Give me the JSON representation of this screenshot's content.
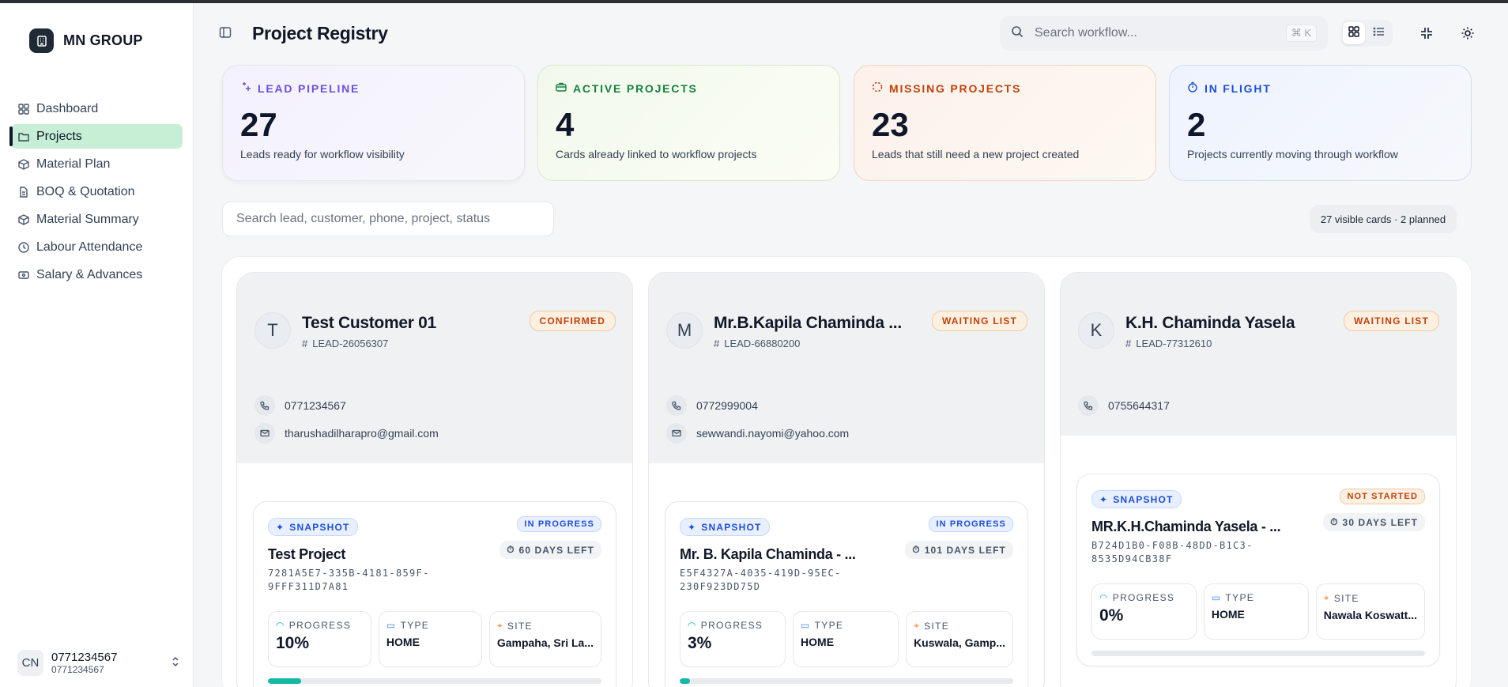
{
  "brand": {
    "name": "MN GROUP"
  },
  "sidebar": {
    "items": [
      {
        "label": "Dashboard",
        "icon": "grid-icon"
      },
      {
        "label": "Projects",
        "icon": "folder-icon"
      },
      {
        "label": "Material Plan",
        "icon": "box-icon"
      },
      {
        "label": "BOQ & Quotation",
        "icon": "document-icon"
      },
      {
        "label": "Material Summary",
        "icon": "box-icon"
      },
      {
        "label": "Labour Attendance",
        "icon": "clock-icon"
      },
      {
        "label": "Salary & Advances",
        "icon": "wallet-icon"
      }
    ],
    "active": "Projects"
  },
  "user": {
    "initials": "CN",
    "name": "0771234567",
    "sub": "0771234567"
  },
  "header": {
    "title": "Project Registry",
    "search_placeholder": "Search workflow...",
    "shortcut": "⌘ K"
  },
  "stats": [
    {
      "label": "LEAD PIPELINE",
      "value": "27",
      "desc": "Leads ready for workflow visibility",
      "color": "#6d4fd8"
    },
    {
      "label": "ACTIVE PROJECTS",
      "value": "4",
      "desc": "Cards already linked to workflow projects",
      "color": "#15803d"
    },
    {
      "label": "MISSING PROJECTS",
      "value": "23",
      "desc": "Leads that still need a new project created",
      "color": "#c2410c"
    },
    {
      "label": "IN FLIGHT",
      "value": "2",
      "desc": "Projects currently moving through workflow",
      "color": "#1d4ed8"
    }
  ],
  "lead_search": {
    "placeholder": "Search lead, customer, phone, project, status"
  },
  "visible_count": "27 visible cards · 2 planned",
  "cards": [
    {
      "letter": "T",
      "name": "Test Customer 01",
      "lead_id": "LEAD-26056307",
      "status": "CONFIRMED",
      "phone": "0771234567",
      "email": "tharushadilharapro@gmail.com",
      "snapshot": {
        "tag": "SNAPSHOT",
        "status": "IN PROGRESS",
        "days": "60 DAYS LEFT",
        "title": "Test Project",
        "uuid": "7281A5E7-335B-4181-859F-9FFF311D7A81",
        "progress_label": "PROGRESS",
        "progress": "10%",
        "progress_value": 10,
        "type_label": "TYPE",
        "type": "HOME",
        "site_label": "SITE",
        "site": "Gampaha, Sri La..."
      }
    },
    {
      "letter": "M",
      "name": "Mr.B.Kapila Chaminda ...",
      "lead_id": "LEAD-66880200",
      "status": "WAITING LIST",
      "phone": "0772999004",
      "email": "sewwandi.nayomi@yahoo.com",
      "snapshot": {
        "tag": "SNAPSHOT",
        "status": "IN PROGRESS",
        "days": "101 DAYS LEFT",
        "title": "Mr. B. Kapila Chaminda - ...",
        "uuid": "E5F4327A-4035-419D-95EC-230F923DD75D",
        "progress_label": "PROGRESS",
        "progress": "3%",
        "progress_value": 3,
        "type_label": "TYPE",
        "type": "HOME",
        "site_label": "SITE",
        "site": "Kuswala, Gamp..."
      }
    },
    {
      "letter": "K",
      "name": "K.H. Chaminda Yasela",
      "lead_id": "LEAD-77312610",
      "status": "WAITING LIST",
      "phone": "0755644317",
      "email": "",
      "snapshot": {
        "tag": "SNAPSHOT",
        "status": "NOT STARTED",
        "days": "30 DAYS LEFT",
        "title": "MR.K.H.Chaminda Yasela - ...",
        "uuid": "B724D1B0-F08B-48DD-B1C3-8535D94CB38F",
        "progress_label": "PROGRESS",
        "progress": "0%",
        "progress_value": 0,
        "type_label": "TYPE",
        "type": "HOME",
        "site_label": "SITE",
        "site": "Nawala Koswatt..."
      }
    }
  ]
}
